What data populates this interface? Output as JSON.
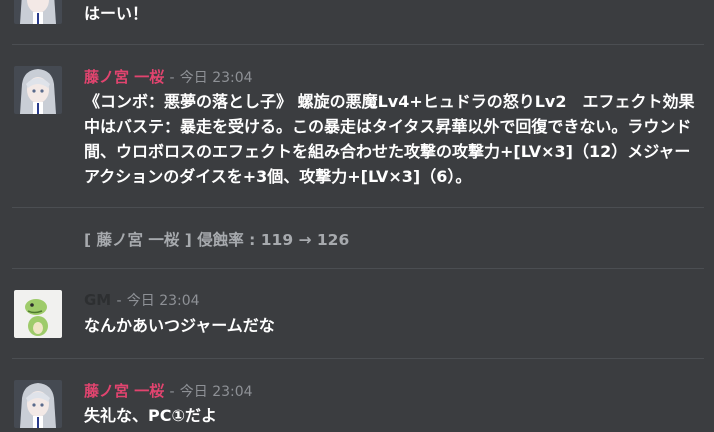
{
  "colors": {
    "background": "#3b3d40",
    "sakura_name": "#e2446f",
    "gm_name": "#2d2f31",
    "timestamp": "#8e9196",
    "system_text": "#a7aaae"
  },
  "messages": [
    {
      "text": "はーい！",
      "avatar": "silver-hair-character-avatar"
    },
    {
      "sender": "藤ノ宮 一桜",
      "separator": "-",
      "time": "今日 23:04",
      "avatar": "silver-hair-character-avatar",
      "text": "《コンボ：悪夢の落とし子》 螺旋の悪魔Lv4+ヒュドラの怒りLv2　エフェクト効果中はバステ：暴走を受ける。この暴走はタイタス昇華以外で回復できない。ラウンド間、ウロボロスのエフェクトを組み合わせた攻撃の攻撃力+[LV×3]（12）メジャーアクションのダイスを+3個、攻撃力+[LV×3]（6）。"
    },
    {
      "system_text": "[ 藤ノ宮 一桜 ] 侵蝕率 : 119 → 126"
    },
    {
      "sender": "GM",
      "separator": "-",
      "time": "今日 23:04",
      "avatar": "green-dinosaur-avatar",
      "text": "なんかあいつジャームだな"
    },
    {
      "sender": "藤ノ宮 一桜",
      "separator": "-",
      "time": "今日 23:04",
      "avatar": "silver-hair-character-avatar",
      "text": "失礼な、PC①だよ"
    }
  ]
}
